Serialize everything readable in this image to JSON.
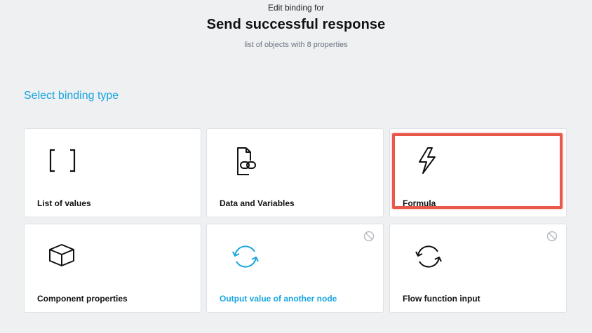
{
  "header": {
    "edit_label": "Edit binding for",
    "title": "Send successful response",
    "subtitle": "list of objects with 8 properties"
  },
  "section_heading": "Select binding type",
  "colors": {
    "accent": "#1aa6e0",
    "highlight": "#e8584b",
    "background": "#eef0f2"
  },
  "cards": [
    {
      "label": "List of values",
      "icon": "brackets-icon",
      "disabled": false
    },
    {
      "label": "Data and Variables",
      "icon": "document-link-icon",
      "disabled": false
    },
    {
      "label": "Formula",
      "icon": "lightning-icon",
      "disabled": false,
      "highlighted": true
    },
    {
      "label": "Component properties",
      "icon": "cube-icon",
      "disabled": false
    },
    {
      "label": "Output value of another node",
      "icon": "refresh-arrows-icon",
      "disabled": true,
      "selected": true
    },
    {
      "label": "Flow function input",
      "icon": "refresh-arrows-icon",
      "disabled": true
    }
  ]
}
